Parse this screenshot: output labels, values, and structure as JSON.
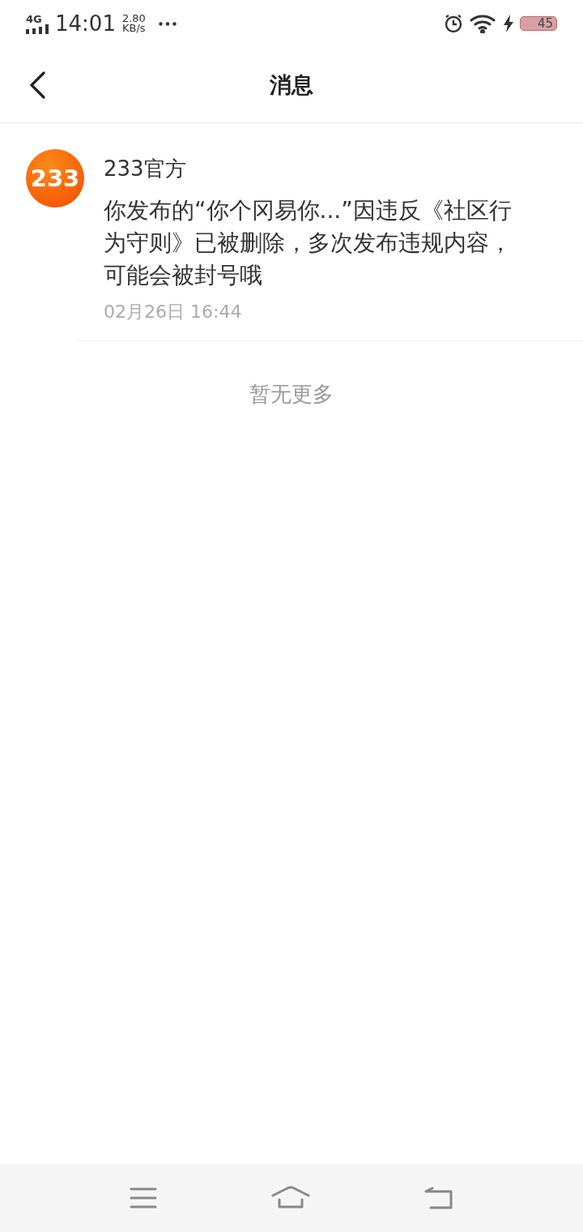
{
  "status_bar": {
    "network": "4G",
    "time": "14:01",
    "speed_value": "2.80",
    "speed_unit": "KB/s",
    "battery": "45"
  },
  "header": {
    "title": "消息"
  },
  "messages": [
    {
      "avatar_text": "233",
      "sender": "233官方",
      "body": "你发布的“你个冈易你...”因违反《社区行为守则》已被删除，多次发布违规内容，可能会被封号哦",
      "time": "02月26日 16:44"
    }
  ],
  "footer_note": "暂无更多"
}
